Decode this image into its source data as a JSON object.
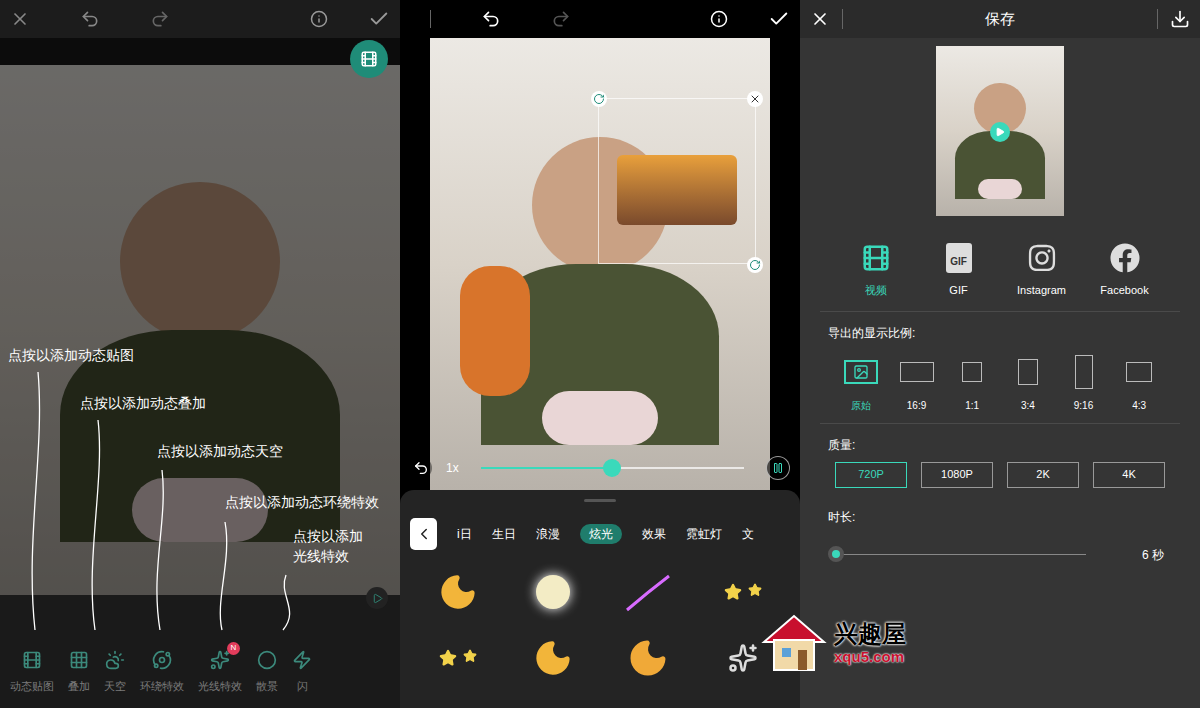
{
  "edit_screen": {
    "hints": [
      "点按以添加动态贴图",
      "点按以添加动态叠加",
      "点按以添加动态天空",
      "点按以添加动态环绕特效",
      "点按以添加光线特效"
    ],
    "tools": [
      {
        "label": "动态贴图",
        "badge": ""
      },
      {
        "label": "叠加",
        "badge": ""
      },
      {
        "label": "天空",
        "badge": ""
      },
      {
        "label": "环绕特效",
        "badge": ""
      },
      {
        "label": "光线特效",
        "badge": "N"
      },
      {
        "label": "散景",
        "badge": ""
      },
      {
        "label": "闪",
        "badge": ""
      }
    ]
  },
  "sticker_screen": {
    "playback": {
      "speed": "1x",
      "level": 0.5,
      "playing": true
    },
    "categories": [
      {
        "label": "i日",
        "selected": false
      },
      {
        "label": "生日",
        "selected": false
      },
      {
        "label": "浪漫",
        "selected": false
      },
      {
        "label": "炫光",
        "selected": true
      },
      {
        "label": "效果",
        "selected": false
      },
      {
        "label": "霓虹灯",
        "selected": false
      },
      {
        "label": "文",
        "selected": false
      }
    ]
  },
  "save_screen": {
    "title": "保存",
    "formats": [
      {
        "label": "视频",
        "selected": true,
        "icon_text": ""
      },
      {
        "label": "GIF",
        "selected": false,
        "icon_text": "GIF"
      },
      {
        "label": "Instagram",
        "selected": false,
        "icon_text": ""
      },
      {
        "label": "Facebook",
        "selected": false,
        "icon_text": ""
      }
    ],
    "ratio_title": "导出的显示比例:",
    "ratios": [
      {
        "label": "原始",
        "selected": true,
        "kind": "image"
      },
      {
        "label": "16:9",
        "selected": false,
        "kind": "wide"
      },
      {
        "label": "1:1",
        "selected": false,
        "kind": "square"
      },
      {
        "label": "3:4",
        "selected": false,
        "kind": "portrait"
      },
      {
        "label": "9:16",
        "selected": false,
        "kind": "tall"
      },
      {
        "label": "4:3",
        "selected": false,
        "kind": "landscape"
      }
    ],
    "quality_title": "质量:",
    "qualities": [
      {
        "label": "720P",
        "selected": true
      },
      {
        "label": "1080P",
        "selected": false
      },
      {
        "label": "2K",
        "selected": false
      },
      {
        "label": "4K",
        "selected": false
      }
    ],
    "duration_title": "时长:",
    "duration": {
      "level": 0,
      "value": "6 秒"
    }
  },
  "watermark": {
    "name": "兴趣屋",
    "url": "xqu5.com"
  }
}
